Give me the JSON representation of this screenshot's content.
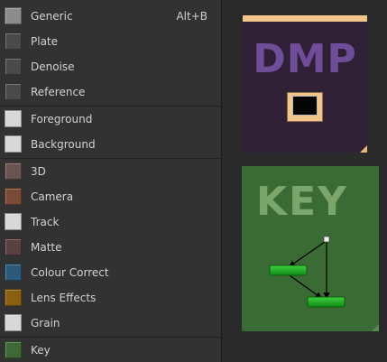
{
  "menu": {
    "items": [
      {
        "label": "Generic",
        "shortcut": "Alt+B",
        "color": "#8c8c8c"
      },
      {
        "label": "Plate",
        "shortcut": "",
        "color": "#4a4a4a"
      },
      {
        "label": "Denoise",
        "shortcut": "",
        "color": "#4a4a4a"
      },
      {
        "label": "Reference",
        "shortcut": "",
        "color": "#4a4a4a"
      },
      {
        "label": "Foreground",
        "shortcut": "",
        "color": "#d8d8d8"
      },
      {
        "label": "Background",
        "shortcut": "",
        "color": "#d8d8d8"
      },
      {
        "label": "3D",
        "shortcut": "",
        "color": "#6a5452"
      },
      {
        "label": "Camera",
        "shortcut": "",
        "color": "#7a4a34"
      },
      {
        "label": "Track",
        "shortcut": "",
        "color": "#d8d8d8"
      },
      {
        "label": "Matte",
        "shortcut": "",
        "color": "#5a4040"
      },
      {
        "label": "Colour Correct",
        "shortcut": "",
        "color": "#2a5a78"
      },
      {
        "label": "Lens Effects",
        "shortcut": "",
        "color": "#8a6010"
      },
      {
        "label": "Grain",
        "shortcut": "",
        "color": "#d8d8d8"
      },
      {
        "label": "Key",
        "shortcut": "",
        "color": "#3d6a34"
      }
    ]
  },
  "preview": {
    "dmp_title": "DMP",
    "key_title": "KEY",
    "dmp_color": "#2f2036",
    "key_color": "#3b6b34"
  }
}
